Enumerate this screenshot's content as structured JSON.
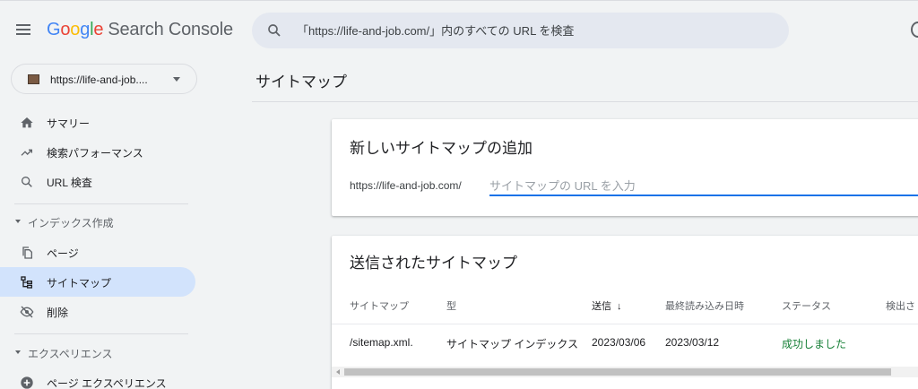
{
  "header": {
    "logo_google": [
      "G",
      "o",
      "o",
      "g",
      "l",
      "e"
    ],
    "logo_suffix": "Search Console",
    "search_placeholder": "「https://life-and-job.com/」内のすべての URL を検査"
  },
  "property": {
    "label": "https://life-and-job...."
  },
  "sidebar": {
    "items": [
      {
        "label": "サマリー",
        "icon": "home-icon"
      },
      {
        "label": "検索パフォーマンス",
        "icon": "trending-up-icon"
      },
      {
        "label": "URL 検査",
        "icon": "search-icon"
      }
    ],
    "index_section": {
      "label": "インデックス作成",
      "items": [
        {
          "label": "ページ",
          "icon": "pages-icon"
        },
        {
          "label": "サイトマップ",
          "icon": "sitemap-icon",
          "active": true
        },
        {
          "label": "削除",
          "icon": "visibility-off-icon"
        }
      ]
    },
    "experience_section": {
      "label": "エクスペリエンス",
      "items": [
        {
          "label": "ページ エクスペリエンス",
          "icon": "add-circle-icon"
        }
      ]
    }
  },
  "main": {
    "title": "サイトマップ",
    "add_card": {
      "title": "新しいサイトマップの追加",
      "prefix": "https://life-and-job.com/",
      "input_placeholder": "サイトマップの URL を入力"
    },
    "submitted_card": {
      "title": "送信されたサイトマップ",
      "columns": [
        "サイトマップ",
        "型",
        "送信",
        "最終読み込み日時",
        "ステータス",
        "検出さ"
      ],
      "sorted_column": "送信",
      "sort_arrow": "↓",
      "rows": [
        [
          "/sitemap.xml.",
          "サイトマップ インデックス",
          "2023/03/06",
          "2023/03/12",
          "成功しました"
        ]
      ]
    }
  },
  "colors": {
    "accent": "#1a73e8",
    "active_nav": "#d2e3fc",
    "success": "#188038"
  }
}
